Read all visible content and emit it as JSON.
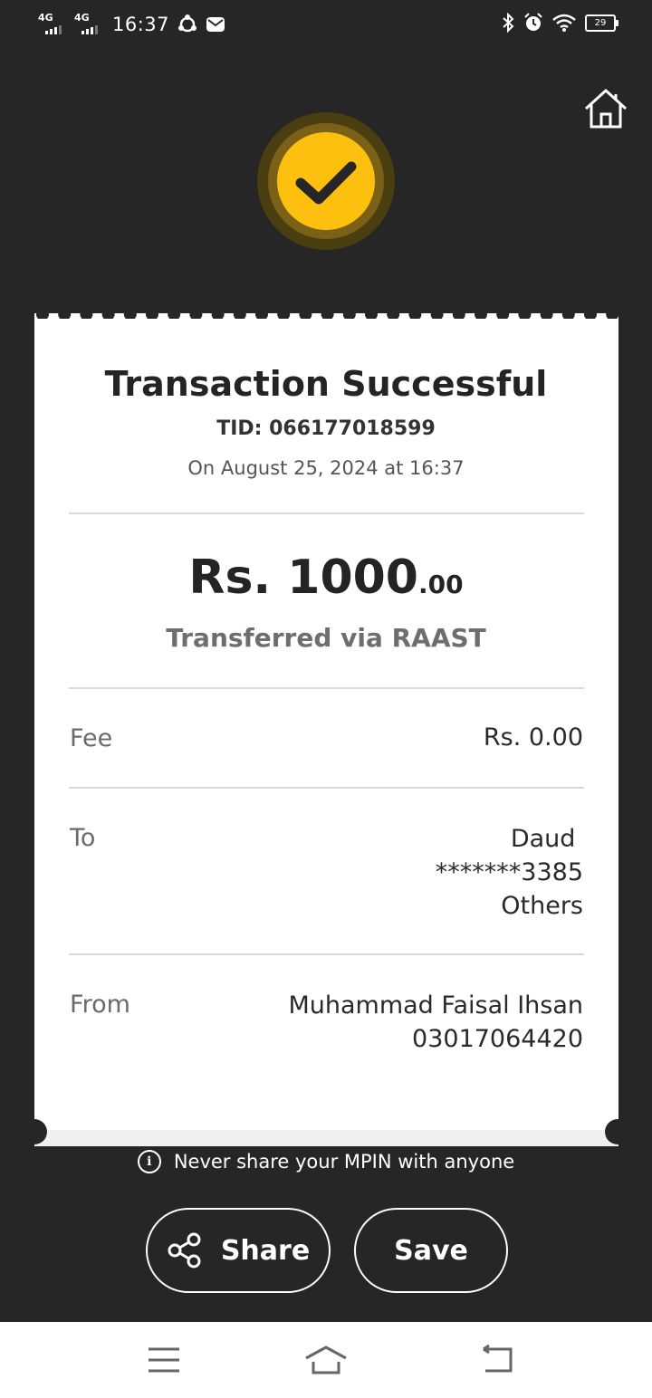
{
  "status_bar": {
    "net1": "4G",
    "net2": "4G",
    "time": "16:37",
    "battery": "29",
    "icons": [
      "signal-icon",
      "signal-icon",
      "sync-icon",
      "mail-icon",
      "bluetooth-icon",
      "alarm-icon",
      "wifi-icon",
      "battery-icon"
    ]
  },
  "header": {
    "home_icon": "home-icon",
    "status_icon": "checkmark-icon"
  },
  "receipt": {
    "title": "Transaction Successful",
    "tid": "TID: 066177018599",
    "date": "On August 25, 2024 at 16:37",
    "amount_main": "Rs. 1000",
    "amount_decimal": ".00",
    "method": "Transferred via RAAST",
    "fee_label": "Fee",
    "fee_value": "Rs. 0.00",
    "to_label": "To",
    "to_name": "Daud ",
    "to_account": "*******3385",
    "to_bank": "Others",
    "from_label": "From",
    "from_name": "Muhammad Faisal Ihsan",
    "from_account": "03017064420"
  },
  "notice": "Never share your MPIN with anyone",
  "actions": {
    "share_label": "Share",
    "save_label": "Save"
  },
  "nav": {
    "icons": [
      "menu-icon",
      "home-nav-icon",
      "back-icon"
    ]
  },
  "colors": {
    "background": "#262626",
    "accent": "#fdc00f",
    "card": "#ffffff"
  }
}
